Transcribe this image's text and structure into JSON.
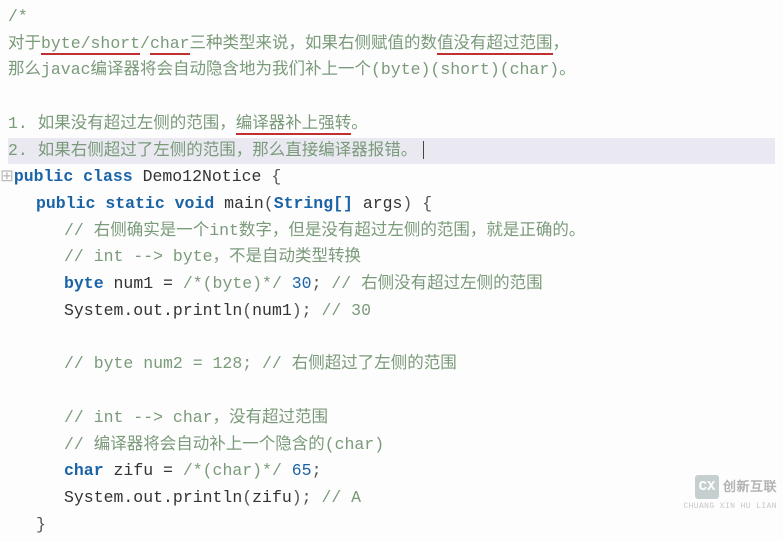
{
  "header": {
    "slashStar": "/*",
    "line_a_prefix": "对于",
    "byte": "byte",
    "slash1": "/",
    "short": "short",
    "slash2": "/",
    "char": "char",
    "line_a_mid": "三种类型来说，如果右侧赋值的数",
    "line_a_underlined2": "值没有超过范围",
    "line_a_suffix": "，",
    "line_b": "那么javac编译器将会自动隐含地为我们补上一个(byte)(short)(char)。",
    "item1_prefix": "1. 如果没有超过左侧的范围，",
    "item1_underlined": "编译器补上强转",
    "item1_suffix": "。",
    "item2": "2. 如果右侧超过了左侧的范围，那么直接编译器报错。"
  },
  "code": {
    "collapse": "⊞",
    "kw_public": "public",
    "kw_class": "class",
    "class_name": "Demo12Notice",
    "brace_open": "{",
    "kw_static": "static",
    "kw_void": "void",
    "main": "main",
    "paren_open": "(",
    "string_arr": "String[]",
    "args": "args",
    "paren_close": ")",
    "c1": "// 右侧确实是一个int数字，但是没有超过左侧的范围，就是正确的。",
    "c2": "// int --> byte，不是自动类型转换",
    "kw_byte": "byte",
    "num1_var": "num1",
    "eq": "=",
    "cast_byte_comment": "/*(byte)*/",
    "val_30": "30",
    "semi": ";",
    "c3_tail": "// 右侧没有超过左侧的范围",
    "sout": "System.out.println",
    "c30": "// 30",
    "c4": "// byte num2 = 128; // 右侧超过了左侧的范围",
    "c5": "// int --> char，没有超过范围",
    "c6": "// 编译器将会自动补上一个隐含的(char)",
    "kw_char": "char",
    "zifu": "zifu",
    "cast_char_comment": "/*(char)*/",
    "val_65": "65",
    "cA": "// A",
    "brace_close": "}"
  },
  "watermark": {
    "brand": "创新互联",
    "icon": "CX",
    "sub": "CHUANG XIN HU LIAN"
  }
}
